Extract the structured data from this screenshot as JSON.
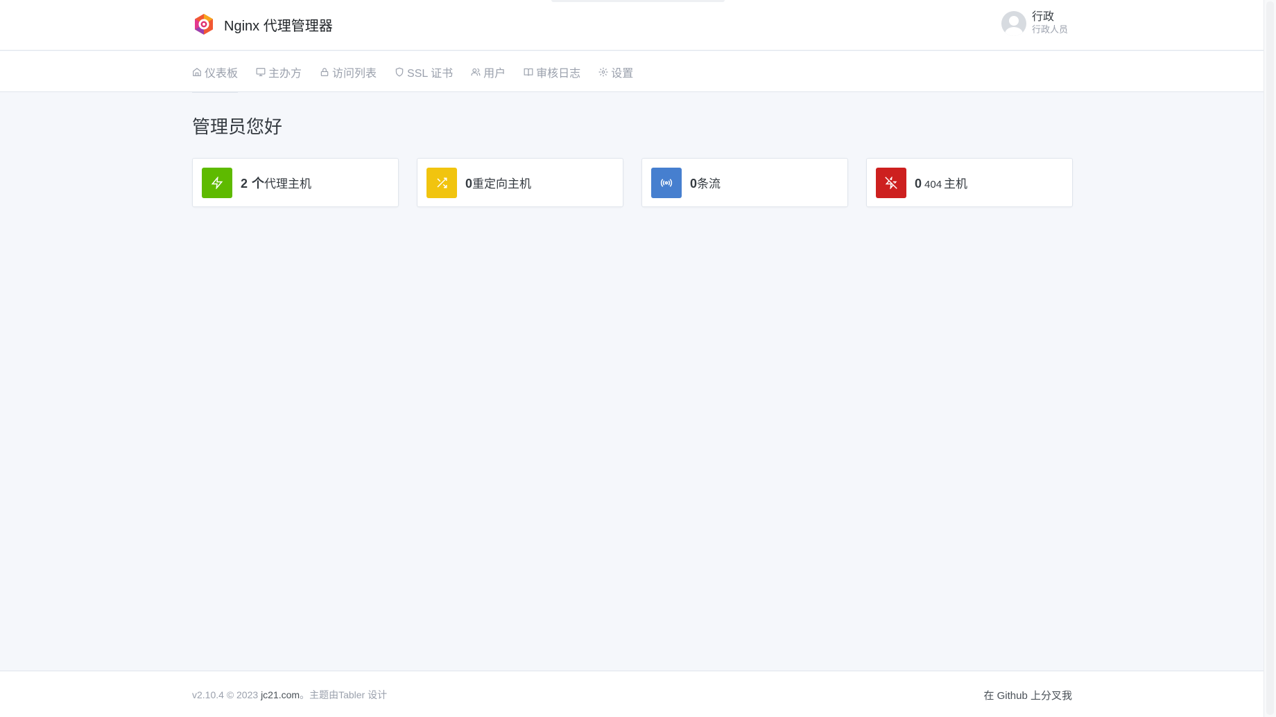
{
  "header": {
    "app_title": "Nginx 代理管理器",
    "user": {
      "name": "行政",
      "role": "行政人员"
    }
  },
  "nav": {
    "items": [
      {
        "label": "仪表板",
        "icon": "home-icon"
      },
      {
        "label": "主办方",
        "icon": "monitor-icon"
      },
      {
        "label": "访问列表",
        "icon": "lock-icon"
      },
      {
        "label": "SSL 证书",
        "icon": "shield-icon"
      },
      {
        "label": "用户",
        "icon": "users-icon"
      },
      {
        "label": "审核日志",
        "icon": "book-open-icon"
      },
      {
        "label": "设置",
        "icon": "settings-icon"
      }
    ],
    "active_index": 0
  },
  "page": {
    "title": "管理员您好"
  },
  "cards": [
    {
      "value": "2",
      "unit": "个",
      "label": "代理主机",
      "icon": "zap-icon",
      "color": "#5eba00"
    },
    {
      "value": "0",
      "unit": "",
      "label": "重定向主机",
      "icon": "shuffle-icon",
      "color": "#f1c40f"
    },
    {
      "value": "0",
      "unit": "",
      "label": "条流",
      "icon": "radio-icon",
      "color": "#467fcf"
    },
    {
      "value": "0",
      "unit": "404",
      "label": "主机",
      "icon": "zap-off-icon",
      "color": "#cd201f"
    }
  ],
  "footer": {
    "version": "v2.10.4 © 2023",
    "link": "jc21.com",
    "credit": "。主题由Tabler 设计",
    "github": "在 Github 上分叉我"
  }
}
